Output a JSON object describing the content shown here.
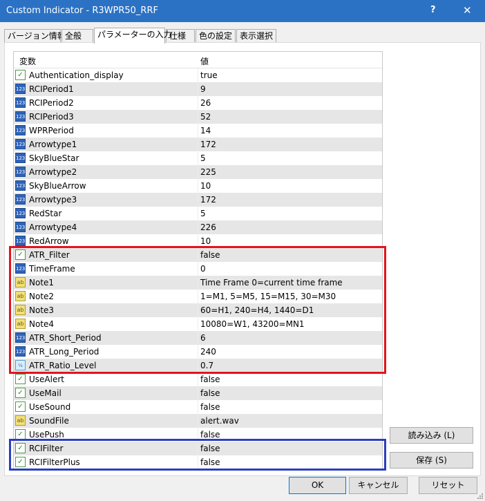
{
  "window": {
    "title": "Custom Indicator - R3WPR50_RRF",
    "help": "?",
    "close": "✕"
  },
  "tabs": [
    {
      "label": "バージョン情報"
    },
    {
      "label": "全般"
    },
    {
      "label": "パラメーターの入力"
    },
    {
      "label": "仕様"
    },
    {
      "label": "色の設定"
    },
    {
      "label": "表示選択"
    }
  ],
  "grid": {
    "col_name": "変数",
    "col_value": "値",
    "rows": [
      {
        "name": "Authentication_display",
        "value": "true",
        "type": "bool"
      },
      {
        "name": "RCIPeriod1",
        "value": "9",
        "type": "num"
      },
      {
        "name": "RCIPeriod2",
        "value": "26",
        "type": "num"
      },
      {
        "name": "RCIPeriod3",
        "value": "52",
        "type": "num"
      },
      {
        "name": "WPRPeriod",
        "value": "14",
        "type": "num"
      },
      {
        "name": "Arrowtype1",
        "value": "172",
        "type": "num"
      },
      {
        "name": "SkyBlueStar",
        "value": "5",
        "type": "num"
      },
      {
        "name": "Arrowtype2",
        "value": "225",
        "type": "num"
      },
      {
        "name": "SkyBlueArrow",
        "value": "10",
        "type": "num"
      },
      {
        "name": "Arrowtype3",
        "value": "172",
        "type": "num"
      },
      {
        "name": "RedStar",
        "value": "5",
        "type": "num"
      },
      {
        "name": "Arrowtype4",
        "value": "226",
        "type": "num"
      },
      {
        "name": "RedArrow",
        "value": "10",
        "type": "num"
      },
      {
        "name": "ATR_Filter",
        "value": "false",
        "type": "bool"
      },
      {
        "name": "TimeFrame",
        "value": "0",
        "type": "num"
      },
      {
        "name": "Note1",
        "value": "Time Frame 0=current time frame",
        "type": "str"
      },
      {
        "name": "Note2",
        "value": "1=M1, 5=M5, 15=M15, 30=M30",
        "type": "str"
      },
      {
        "name": "Note3",
        "value": "60=H1, 240=H4, 1440=D1",
        "type": "str"
      },
      {
        "name": "Note4",
        "value": "10080=W1, 43200=MN1",
        "type": "str"
      },
      {
        "name": "ATR_Short_Period",
        "value": "6",
        "type": "num"
      },
      {
        "name": "ATR_Long_Period",
        "value": "240",
        "type": "num"
      },
      {
        "name": "ATR_Ratio_Level",
        "value": "0.7",
        "type": "dbl"
      },
      {
        "name": "UseAlert",
        "value": "false",
        "type": "bool"
      },
      {
        "name": "UseMail",
        "value": "false",
        "type": "bool"
      },
      {
        "name": "UseSound",
        "value": "false",
        "type": "bool"
      },
      {
        "name": "SoundFile",
        "value": "alert.wav",
        "type": "str"
      },
      {
        "name": "UsePush",
        "value": "false",
        "type": "bool"
      },
      {
        "name": "RCIFilter",
        "value": "false",
        "type": "bool"
      },
      {
        "name": "RCIFilterPlus",
        "value": "false",
        "type": "bool"
      }
    ]
  },
  "buttons": {
    "load": "読み込み (L)",
    "save": "保存 (S)",
    "ok": "OK",
    "cancel": "キャンセル",
    "reset": "リセット"
  },
  "colors": {
    "titlebar": "#2b72c4",
    "highlight_red": "#e3141b",
    "highlight_blue": "#2c3ec0"
  }
}
